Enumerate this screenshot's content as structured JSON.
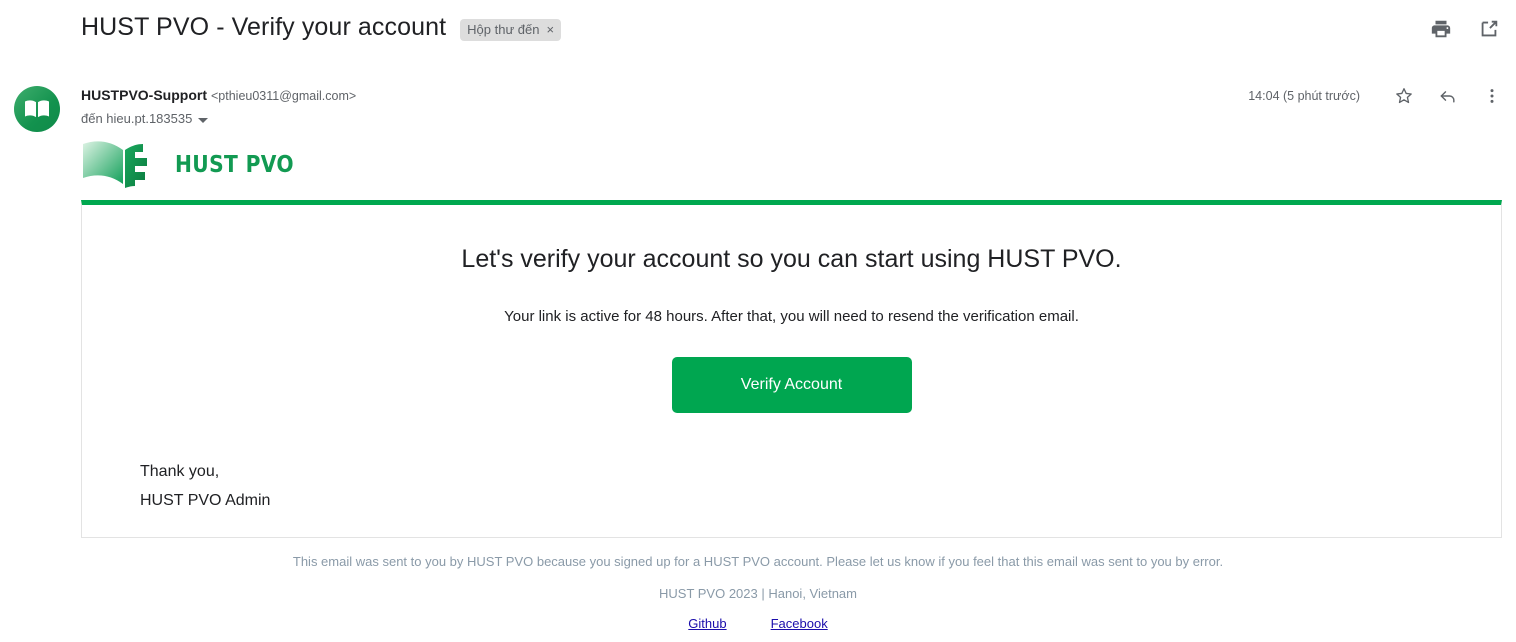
{
  "header": {
    "subject": "HUST PVO - Verify your account",
    "label_chip": {
      "text": "Hộp thư đến",
      "remove": "×"
    },
    "actions": [
      {
        "name": "print-icon",
        "title": "In tất cả"
      },
      {
        "name": "open-in-new-window-icon",
        "title": "Mở trong cửa sổ mới"
      }
    ]
  },
  "message": {
    "sender_name": "HUSTPVO-Support",
    "sender_email": "<pthieu0311@gmail.com>",
    "recipient_line": "đến hieu.pt.183535",
    "timestamp": "14:04 (5 phút trước)",
    "actions": [
      {
        "name": "star-icon"
      },
      {
        "name": "reply-icon"
      },
      {
        "name": "more-options-icon"
      }
    ]
  },
  "brand": {
    "logo_text": "HUST PVO",
    "logo_color": "#129a52",
    "avatar_color": "#13924e"
  },
  "body": {
    "heading": "Let's verify your account so you can start using HUST PVO.",
    "subtext": "Your link is active for 48 hours. After that, you will need to resend the verification email.",
    "cta_label": "Verify Account",
    "cta_color": "#00a650",
    "accent_border_color": "#00a84f",
    "signoff_line1": "Thank you,",
    "signoff_line2": "HUST PVO Admin"
  },
  "footer": {
    "disclaimer": "This email was sent to you by HUST PVO because you signed up for a HUST PVO account. Please let us know if you feel that this email was sent to you by error.",
    "copyright": "HUST PVO 2023 | Hanoi, Vietnam",
    "links": [
      {
        "label": "Github"
      },
      {
        "label": "Facebook"
      }
    ],
    "link_color": "#1a0dab",
    "text_color": "#8a9aa8"
  }
}
